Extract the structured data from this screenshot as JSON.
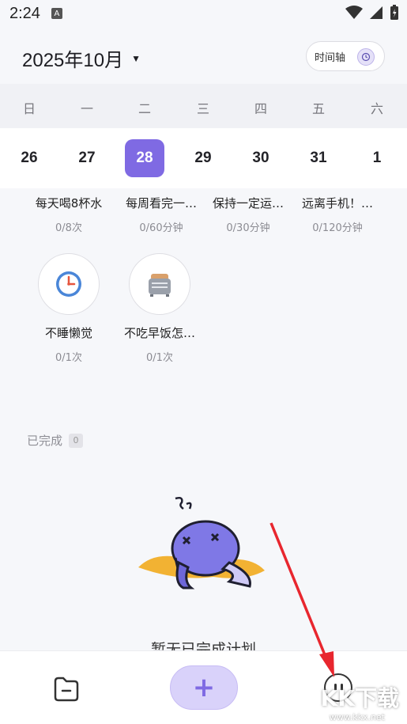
{
  "status": {
    "time": "2:24",
    "a_badge": "A"
  },
  "header": {
    "month": "2025年10月",
    "timeline_label": "时间轴"
  },
  "weekdays": [
    "日",
    "一",
    "二",
    "三",
    "四",
    "五",
    "六"
  ],
  "dates": [
    "26",
    "27",
    "28",
    "29",
    "30",
    "31",
    "1"
  ],
  "selected_date_index": 2,
  "habits_row1": [
    {
      "name": "每天喝8杯水",
      "count": "0/8次"
    },
    {
      "name": "每周看完一…",
      "count": "0/60分钟"
    },
    {
      "name": "保持一定运…",
      "count": "0/30分钟"
    },
    {
      "name": "远离手机！…",
      "count": "0/120分钟"
    }
  ],
  "habits_row2": [
    {
      "name": "不睡懒觉",
      "count": "0/1次",
      "icon": "alarm-clock-icon"
    },
    {
      "name": "不吃早饭怎…",
      "count": "0/1次",
      "icon": "toaster-icon"
    }
  ],
  "completed": {
    "label": "已完成",
    "count": "0"
  },
  "empty_state": {
    "text": "暂无已完成计划"
  },
  "bottom_nav": {
    "add_label": "+"
  },
  "watermark": {
    "text": "KK下载",
    "url": "www.kkx.net"
  },
  "colors": {
    "accent": "#7f6ae3",
    "accent_light": "#d9d2fa",
    "arrow": "#e8262e"
  }
}
